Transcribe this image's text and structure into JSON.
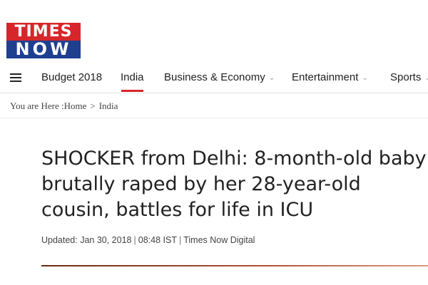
{
  "logo": {
    "line1": "TIMES",
    "line2": "NOW"
  },
  "nav": {
    "items": [
      {
        "label": "Budget 2018",
        "active": false,
        "dropdown": false
      },
      {
        "label": "India",
        "active": true,
        "dropdown": false
      },
      {
        "label": "Business & Economy",
        "active": false,
        "dropdown": true
      },
      {
        "label": "Entertainment",
        "active": false,
        "dropdown": true
      },
      {
        "label": "Sports",
        "active": false,
        "dropdown": true
      }
    ],
    "chevron": "⌄"
  },
  "breadcrumb": {
    "prefix": "You are Here :",
    "home": "Home",
    "separator": ">",
    "current": "India"
  },
  "article": {
    "headline": "SHOCKER from Delhi: 8-month-old baby brutally raped by her 28-year-old cousin, battles for life in ICU",
    "updated_label": "Updated: Jan 30, 2018",
    "time": "08:48 IST",
    "source": "Times Now Digital",
    "pipe": "|"
  },
  "colors": {
    "brand_red": "#d7262b",
    "brand_blue": "#1f3f8f"
  }
}
